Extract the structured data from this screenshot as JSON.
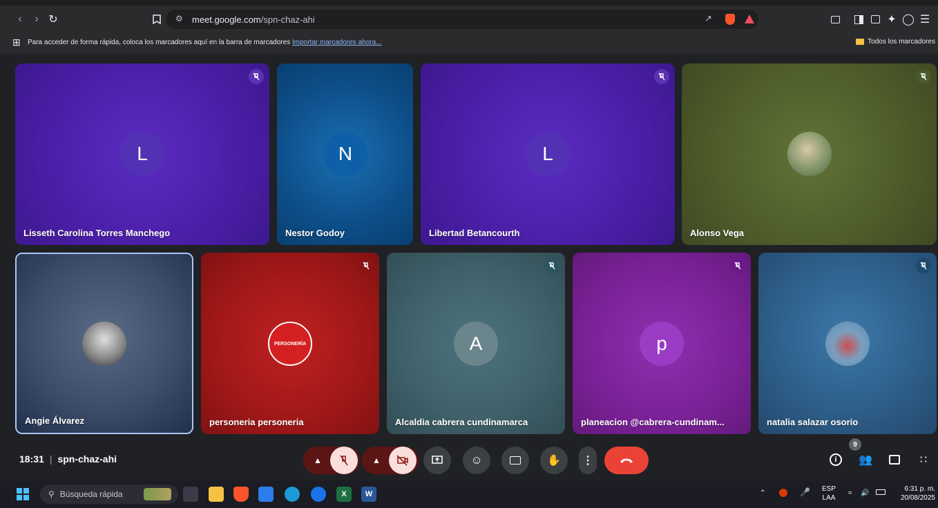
{
  "browser": {
    "url_host": "meet.google.com",
    "url_path": "/spn-chaz-ahi",
    "bookmarks_message": "Para acceder de forma rápida, coloca los marcadores aquí en la barra de marcadores",
    "bookmarks_link": "Importar marcadores ahora...",
    "all_bookmarks": "Todos los marcadores"
  },
  "participants": [
    {
      "name": "Lisseth Carolina Torres Manchego",
      "initial": "L",
      "muted": true,
      "color": "#4a1fa6"
    },
    {
      "name": "Nestor Godoy",
      "initial": "N",
      "muted": false,
      "color": "#0d4f8a"
    },
    {
      "name": "Libertad Betancourth",
      "initial": "L",
      "muted": true,
      "color": "#4a1fa6"
    },
    {
      "name": "Alonso Vega",
      "initial": "",
      "muted": true,
      "color": "#4f5e2a"
    },
    {
      "name": "Angie Álvarez",
      "initial": "",
      "muted": false,
      "color": "#3d4e6b"
    },
    {
      "name": "personeria personeria",
      "initial": "",
      "muted": true,
      "color": "#a01818",
      "logo_text": "PERSONERÍA"
    },
    {
      "name": "Alcaldia cabrera cundinamarca",
      "initial": "A",
      "muted": true,
      "color": "#3f6069"
    },
    {
      "name": "planeacion @cabrera-cundinam...",
      "initial": "p",
      "muted": true,
      "color": "#7a2196"
    },
    {
      "name": "natalia salazar osorio",
      "initial": "",
      "muted": true,
      "color": "#2e5f8a"
    }
  ],
  "meeting": {
    "time": "18:31",
    "code": "spn-chaz-ahi",
    "participant_count": "9"
  },
  "taskbar": {
    "search_placeholder": "Búsqueda rápida",
    "lang_top": "ESP",
    "lang_bottom": "LAA",
    "clock_time": "6:31 p. m.",
    "clock_date": "20/08/2025"
  }
}
